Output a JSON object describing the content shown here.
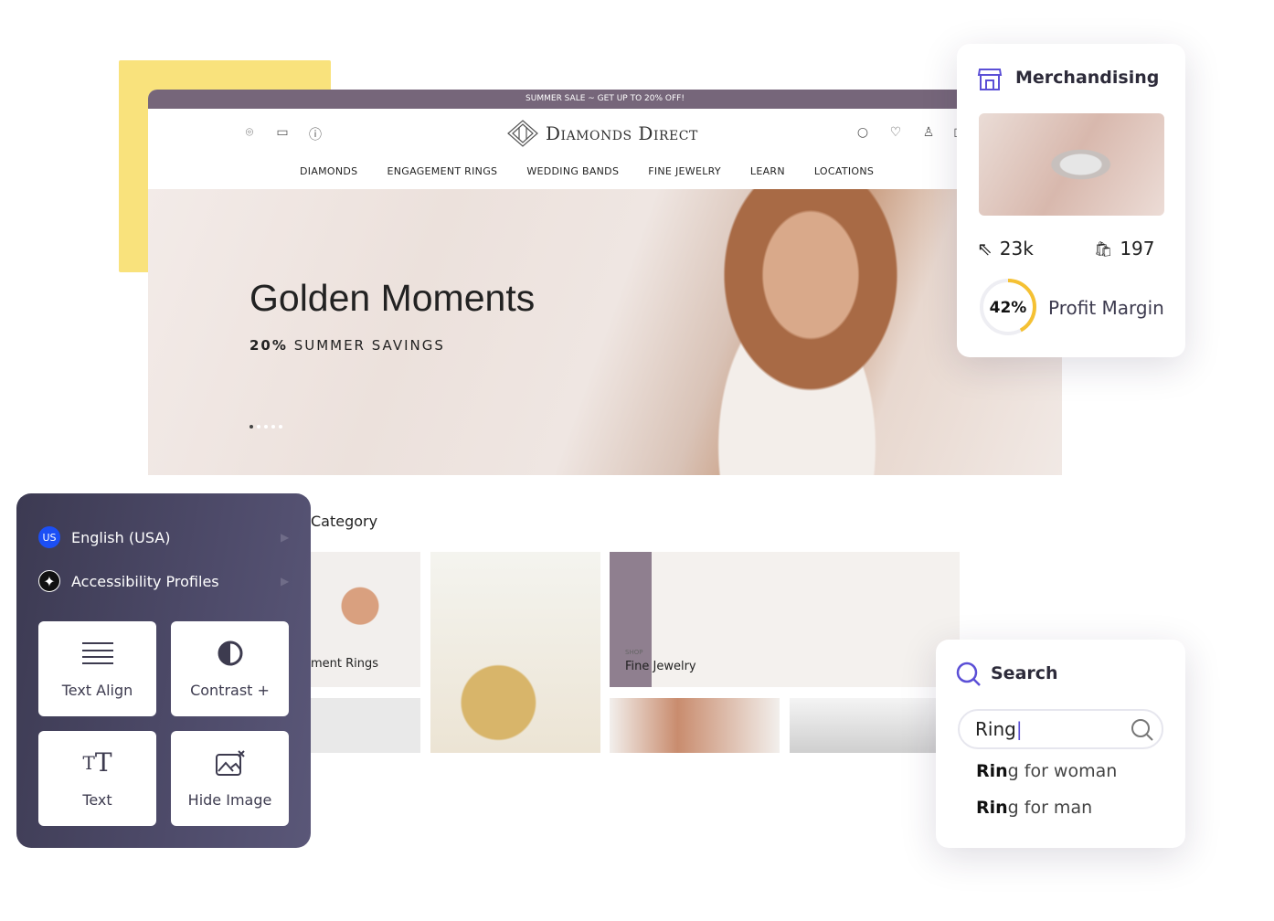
{
  "website": {
    "promo_bar": "SUMMER SALE ~ GET UP TO 20% OFF!",
    "brand": "Diamonds Direct",
    "header_icons_left": [
      "location-pin-icon",
      "calendar-icon",
      "info-icon"
    ],
    "header_icons_right": [
      "search-icon",
      "heart-icon",
      "user-icon",
      "cart-icon"
    ],
    "nav": [
      "DIAMONDS",
      "ENGAGEMENT RINGS",
      "WEDDING BANDS",
      "FINE JEWELRY",
      "LEARN",
      "LOCATIONS"
    ],
    "hero": {
      "title": "Golden Moments",
      "subtitle_bold": "20%",
      "subtitle": "SUMMER SAVINGS",
      "slide_count": 5,
      "active_slide": 1
    },
    "category_title": "Category",
    "tiles": {
      "engagement_label": "ment Rings",
      "fine_jewelry_kicker": "SHOP",
      "fine_jewelry_label": "Fine Jewelry"
    }
  },
  "merchandising": {
    "title": "Merchandising",
    "clicks": "23k",
    "purchases": "197",
    "profit_percent_label": "42%",
    "profit_fraction": 0.42,
    "profit_label": "Profit Margin",
    "accent": "#5b4fd6",
    "ring_color": "#f5c133"
  },
  "accessibility": {
    "language": "English (USA)",
    "language_badge": "US",
    "profiles": "Accessibility Profiles",
    "buttons": [
      "Text Align",
      "Contrast +",
      "Text",
      "Hide Image"
    ]
  },
  "search": {
    "title": "Search",
    "value": "Ring",
    "suggestions": [
      {
        "match": "Rin",
        "rest": "g for woman"
      },
      {
        "match": "Rin",
        "rest": "g for man"
      }
    ]
  }
}
